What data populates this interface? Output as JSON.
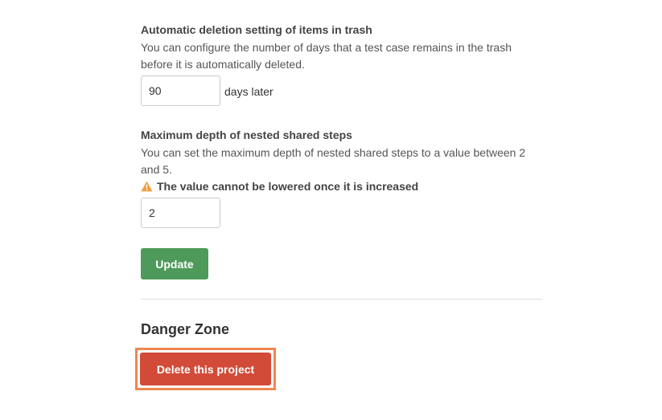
{
  "trash": {
    "title": "Automatic deletion setting of items in trash",
    "description": "You can configure the number of days that a test case remains in the trash before it is automatically deleted.",
    "days_value": "90",
    "days_suffix": "days later"
  },
  "nested_steps": {
    "title": "Maximum depth of nested shared steps",
    "description": "You can set the maximum depth of nested shared steps to a value between 2 and 5.",
    "warning_icon": "warning-triangle-icon",
    "warning_text": "The value cannot be lowered once it is increased",
    "depth_value": "2"
  },
  "actions": {
    "update_label": "Update"
  },
  "danger_zone": {
    "title": "Danger Zone",
    "delete_label": "Delete this project"
  },
  "colors": {
    "update_button": "#4e9a5a",
    "delete_button": "#d14b38",
    "highlight_border": "#f0874f",
    "warning_icon": "#f0a040"
  }
}
